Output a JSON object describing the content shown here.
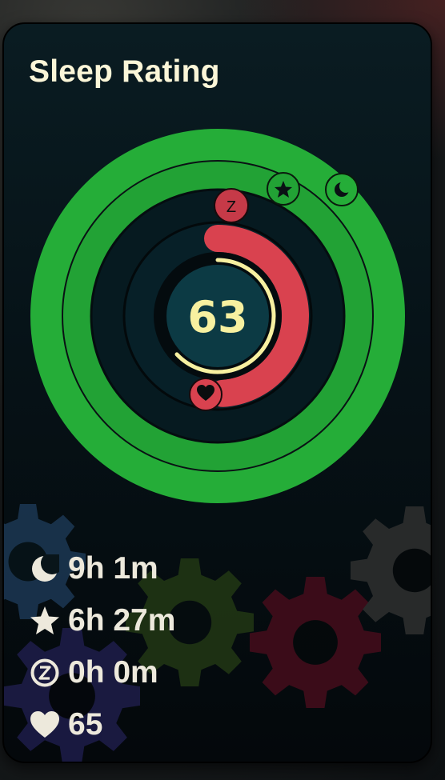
{
  "card": {
    "title": "Sleep Rating"
  },
  "rating": {
    "score": "63",
    "score_fraction": 0.63
  },
  "rings": {
    "outer_ring": {
      "icon": "moon-icon",
      "color": "#25ad38",
      "fraction": 1.0
    },
    "middle_ring": {
      "icon": "star-icon",
      "color": "#22a235",
      "fraction": 1.0
    },
    "inner_ring": {
      "icon": "sleep-z-icon",
      "color": "#d9424f",
      "fraction": 0.5
    },
    "inner_ring_end_icon": "heart-icon",
    "score_arc_color": "#f7f0a0",
    "z_badge_label": "Z"
  },
  "stats": [
    {
      "icon": "moon-icon",
      "value": "9h 1m"
    },
    {
      "icon": "star-icon",
      "value": "6h 27m"
    },
    {
      "icon": "sleep-z-icon",
      "value": "0h 0m"
    },
    {
      "icon": "heart-icon",
      "value": "65"
    }
  ],
  "colors": {
    "title": "#fbf6d8",
    "stat_text": "#ede9dc",
    "center_fill": "#0c3a44"
  }
}
